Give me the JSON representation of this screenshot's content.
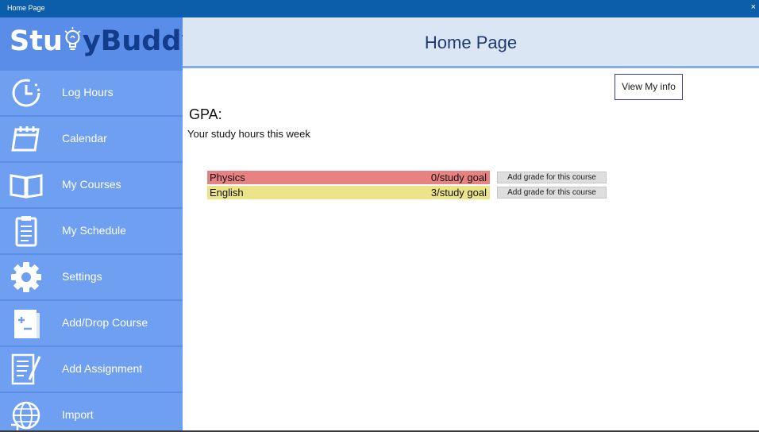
{
  "window": {
    "title": "Home Page",
    "close_glyph": "×"
  },
  "logo": {
    "part1": "Stu",
    "part2": "yBuddy",
    "icon": "lightbulb-icon"
  },
  "sidebar": {
    "items": [
      {
        "label": "Log Hours",
        "icon": "clock-icon"
      },
      {
        "label": "Calendar",
        "icon": "calendar-icon"
      },
      {
        "label": "My Courses",
        "icon": "book-icon"
      },
      {
        "label": "My Schedule",
        "icon": "clipboard-icon"
      },
      {
        "label": "Settings",
        "icon": "gear-icon"
      },
      {
        "label": "Add/Drop Course",
        "icon": "plus-minus-icon"
      },
      {
        "label": "Add Assignment",
        "icon": "document-pen-icon"
      },
      {
        "label": "Import",
        "icon": "globe-arrow-icon"
      }
    ]
  },
  "header": {
    "title": "Home Page"
  },
  "main": {
    "view_info_label": "View My info",
    "gpa_label": "GPA:",
    "hours_label": "Your study hours this week",
    "courses": [
      {
        "name": "Physics",
        "goal": "0/study goal",
        "color": "#e88181",
        "button": "Add grade for this course"
      },
      {
        "name": "English",
        "goal": "3/study goal",
        "color": "#ebe488",
        "button": "Add grade for this course"
      }
    ]
  },
  "colors": {
    "titlebar": "#0c5daa",
    "sidebar": "#6e9ff0",
    "logo_bg": "#5a8de8",
    "logo_dark": "#123c8c",
    "header_bg": "#dbe6f4",
    "header_text": "#1f3a70"
  }
}
